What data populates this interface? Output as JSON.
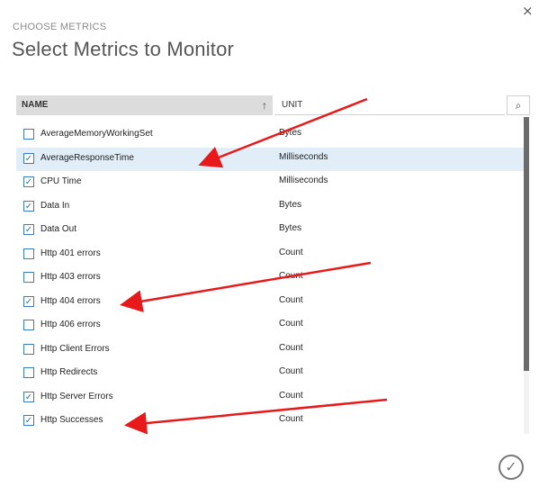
{
  "dialog": {
    "kicker": "CHOOSE METRICS",
    "title": "Select Metrics to Monitor",
    "close_icon": "×",
    "ok_icon": "✓"
  },
  "grid": {
    "col_name": "NAME",
    "col_unit": "UNIT",
    "sort_icon": "↑",
    "search_icon": "⌕"
  },
  "rows": [
    {
      "name": "AverageMemoryWorkingSet",
      "unit": "Bytes",
      "checked": false,
      "highlight": false
    },
    {
      "name": "AverageResponseTime",
      "unit": "Milliseconds",
      "checked": true,
      "highlight": true
    },
    {
      "name": "CPU Time",
      "unit": "Milliseconds",
      "checked": true,
      "highlight": false
    },
    {
      "name": "Data In",
      "unit": "Bytes",
      "checked": true,
      "highlight": false
    },
    {
      "name": "Data Out",
      "unit": "Bytes",
      "checked": true,
      "highlight": false
    },
    {
      "name": "Http 401 errors",
      "unit": "Count",
      "checked": false,
      "highlight": false
    },
    {
      "name": "Http 403 errors",
      "unit": "Count",
      "checked": false,
      "highlight": false
    },
    {
      "name": "Http 404 errors",
      "unit": "Count",
      "checked": true,
      "highlight": false
    },
    {
      "name": "Http 406 errors",
      "unit": "Count",
      "checked": false,
      "highlight": false
    },
    {
      "name": "Http Client Errors",
      "unit": "Count",
      "checked": false,
      "highlight": false
    },
    {
      "name": "Http Redirects",
      "unit": "Count",
      "checked": false,
      "highlight": false
    },
    {
      "name": "Http Server Errors",
      "unit": "Count",
      "checked": true,
      "highlight": false
    },
    {
      "name": "Http Successes",
      "unit": "Count",
      "checked": true,
      "highlight": false
    }
  ],
  "colors": {
    "accent": "#3b7bbf",
    "highlight_row": "#e1eef7",
    "annotation_arrow": "#e8191a"
  }
}
